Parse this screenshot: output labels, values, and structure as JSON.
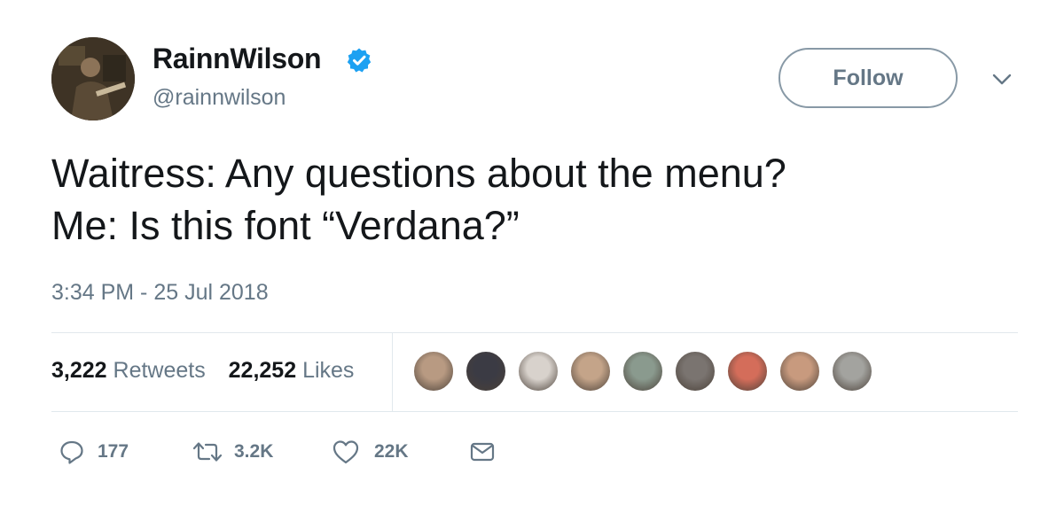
{
  "author": {
    "display_name": "RainnWilson",
    "handle": "@rainnwilson",
    "verified": true
  },
  "header": {
    "follow_label": "Follow"
  },
  "tweet": {
    "lines": [
      "Waitress: Any questions about the menu?",
      "Me: Is this font “Verdana?”"
    ],
    "timestamp": "3:34 PM - 25 Jul 2018"
  },
  "stats": {
    "retweets_count": "3,222",
    "retweets_label": "Retweets",
    "likes_count": "22,252",
    "likes_label": "Likes"
  },
  "likers": [
    {
      "color": "#b89a82"
    },
    {
      "color": "#3b3b44"
    },
    {
      "color": "#d8d2cc"
    },
    {
      "color": "#c4a489"
    },
    {
      "color": "#8a9a8e"
    },
    {
      "color": "#7a7470"
    },
    {
      "color": "#d46d5a"
    },
    {
      "color": "#c89a7e"
    },
    {
      "color": "#a3a39f"
    }
  ],
  "actions": {
    "reply_count": "177",
    "retweet_count": "3.2K",
    "like_count": "22K"
  },
  "colors": {
    "verified_blue": "#1da1f2",
    "secondary_text": "#657786",
    "primary_text": "#14171a"
  },
  "icons": [
    "verified-icon",
    "caret-down-icon",
    "reply-icon",
    "retweet-icon",
    "heart-icon",
    "envelope-icon"
  ]
}
